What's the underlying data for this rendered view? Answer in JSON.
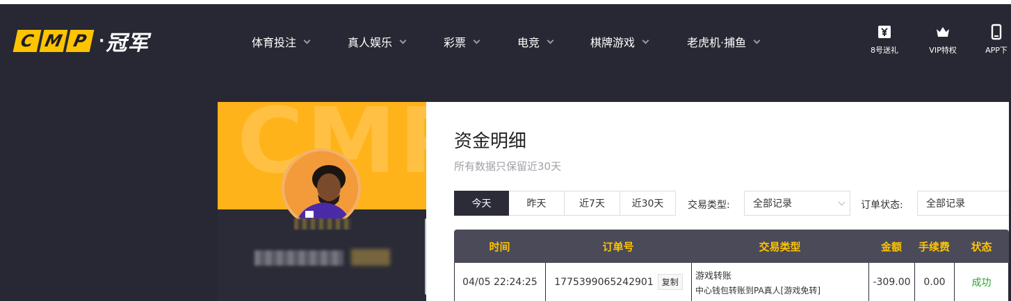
{
  "header": {
    "logo_letters": [
      "C",
      "M",
      "P"
    ],
    "logo_dot": "·",
    "logo_cn": "冠军",
    "nav": [
      {
        "label": "体育投注"
      },
      {
        "label": "真人娱乐"
      },
      {
        "label": "彩票"
      },
      {
        "label": "电竞"
      },
      {
        "label": "棋牌游戏"
      },
      {
        "label": "老虎机·捕鱼"
      }
    ],
    "right_icons": [
      {
        "label": "8号送礼",
        "icon": "gift-ticket-icon"
      },
      {
        "label": "VIP特权",
        "icon": "crown-icon"
      },
      {
        "label": "APP下",
        "icon": "phone-icon"
      }
    ]
  },
  "profile": {
    "bg_text": "CMP"
  },
  "main": {
    "title": "资金明细",
    "subtitle": "所有数据只保留近30天",
    "tabs": [
      {
        "label": "今天",
        "active": true
      },
      {
        "label": "昨天",
        "active": false
      },
      {
        "label": "近7天",
        "active": false
      },
      {
        "label": "近30天",
        "active": false
      }
    ],
    "filters": {
      "type_label": "交易类型:",
      "type_value": "全部记录",
      "status_label": "订单状态:",
      "status_value": "全部记录"
    },
    "table": {
      "headers": [
        "时间",
        "订单号",
        "交易类型",
        "金额",
        "手续费",
        "状态"
      ],
      "rows": [
        {
          "time": "04/05 22:24:25",
          "order_no": "1775399065242901",
          "copy_label": "复制",
          "type_title": "游戏转账",
          "type_detail": "中心钱包转账到PA真人[游戏免转]",
          "amount": "-309.00",
          "fee": "0.00",
          "status": "成功"
        }
      ]
    }
  },
  "colors": {
    "accent": "#ffc400",
    "dark_bg": "#272833",
    "success": "#2aa02a"
  }
}
